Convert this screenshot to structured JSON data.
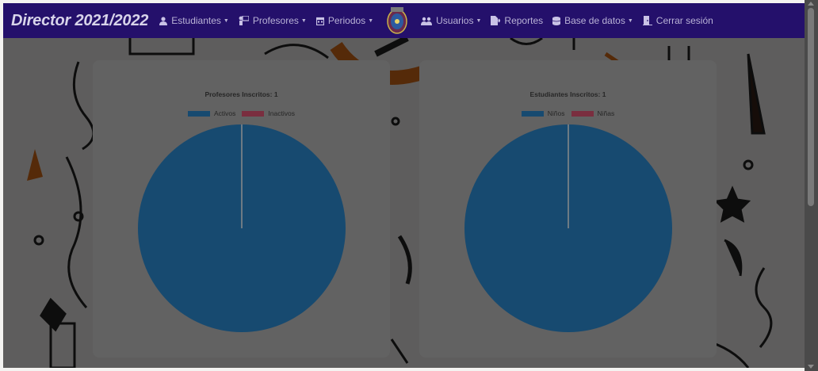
{
  "navbar": {
    "brand": "Director 2021/2022",
    "items": [
      {
        "label": "Estudiantes",
        "icon": "user-icon",
        "dropdown": true
      },
      {
        "label": "Profesores",
        "icon": "teacher-icon",
        "dropdown": true
      },
      {
        "label": "Periodos",
        "icon": "calendar-icon",
        "dropdown": true
      },
      {
        "label": "Usuarios",
        "icon": "users-icon",
        "dropdown": true
      },
      {
        "label": "Reportes",
        "icon": "file-export-icon",
        "dropdown": false
      },
      {
        "label": "Base de datos",
        "icon": "database-icon",
        "dropdown": true
      },
      {
        "label": "Cerrar sesión",
        "icon": "door-exit-icon",
        "dropdown": false
      }
    ],
    "caret": "▼"
  },
  "colors": {
    "navbar": "#24106b",
    "series_primary": "#174a70",
    "series_secondary": "#7a2e3f"
  },
  "chart_data": [
    {
      "type": "pie",
      "title": "Profesores Inscritos: 1",
      "categories": [
        "Activos",
        "Inactivos"
      ],
      "values": [
        1,
        0
      ],
      "legend": "top"
    },
    {
      "type": "pie",
      "title": "Estudiantes Inscritos: 1",
      "categories": [
        "Niños",
        "Niñas"
      ],
      "values": [
        1,
        0
      ],
      "legend": "top"
    }
  ]
}
